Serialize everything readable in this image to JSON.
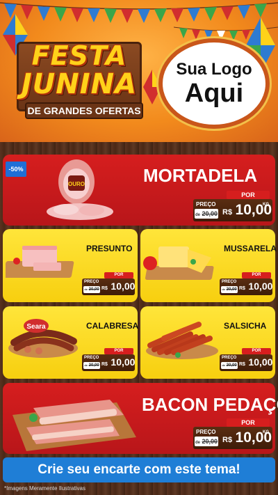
{
  "header": {
    "title_line1": "FESTA",
    "title_line2": "JUNINA",
    "subtitle": "DE GRANDES OFERTAS",
    "logo_line1": "Sua Logo",
    "logo_line2": "Aqui"
  },
  "labels": {
    "por": "POR",
    "preco": "PREÇO",
    "de": "de",
    "currency": "R$",
    "kg": "KG"
  },
  "products": [
    {
      "name": "MORTADELA",
      "old_price": "20,00",
      "new_price": "10,00",
      "badge": "-50%",
      "brand": "OURO"
    },
    {
      "name": "PRESUNTO",
      "old_price": "20,00",
      "new_price": "10,00"
    },
    {
      "name": "MUSSARELA",
      "old_price": "20,00",
      "new_price": "10,00"
    },
    {
      "name": "CALABRESA",
      "old_price": "20,00",
      "new_price": "10,00",
      "brand": "Seara"
    },
    {
      "name": "SALSICHA",
      "old_price": "20,00",
      "new_price": "10,00"
    },
    {
      "name": "BACON PEDAÇO",
      "old_price": "20,00",
      "new_price": "10,00"
    }
  ],
  "cta": "Crie seu encarte com este tema!",
  "footnote": "*Imagens Meramente Ilustrativas",
  "colors": {
    "header_orange": "#f28a1c",
    "card_red": "#d61e1e",
    "card_yellow": "#f7cf0f",
    "title_yellow": "#ffd21a",
    "price_plate": "#4a2410",
    "cta_blue": "#1f7ed6"
  }
}
